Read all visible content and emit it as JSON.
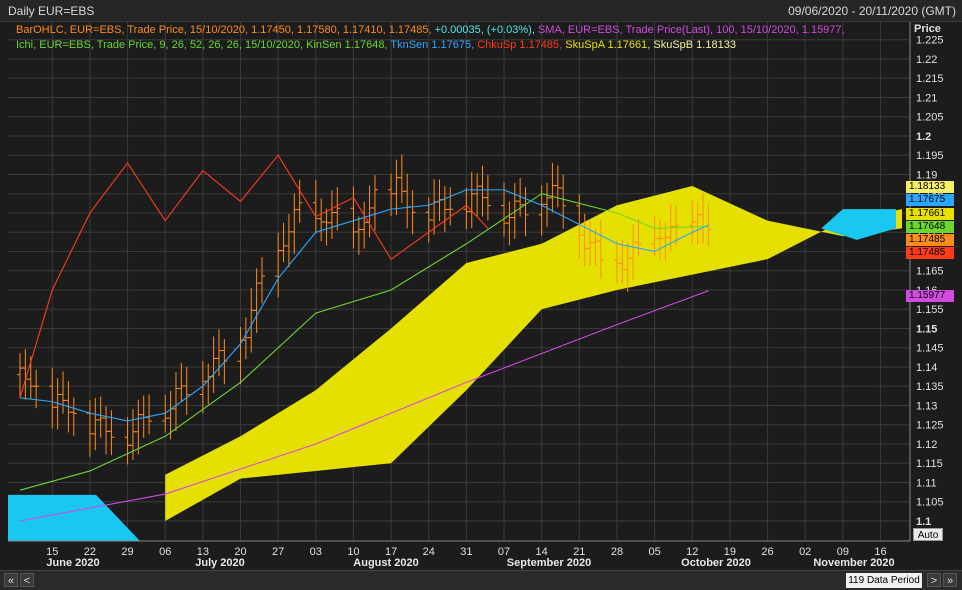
{
  "header": {
    "title": "Daily EUR=EBS",
    "date_range": "09/06/2020 - 20/11/2020 (GMT)"
  },
  "legend": {
    "line1": [
      {
        "text": "BarOHLC, EUR=EBS, Trade Price, 15/10/2020, 1.17450, 1.17580, 1.17410, 1.17485,",
        "color": "#ff8c1a"
      },
      {
        "text": " +0.00035, (+0.03%),",
        "color": "#4fe8e8"
      },
      {
        "text": " SMA, EUR=EBS, Trade Price(Last), 100, 15/10/2020, 1.15977,",
        "color": "#d24be0"
      }
    ],
    "line2": [
      {
        "text": "Ichi, EUR=EBS, Trade Price, 9, 26, 52, 26, 26, 15/10/2020, KinSen 1.17648,",
        "color": "#6bd62e"
      },
      {
        "text": " TknSen 1.17675,",
        "color": "#2aa7ff"
      },
      {
        "text": " ChkuSp 1.17485,",
        "color": "#ff3b1a"
      },
      {
        "text": " SkuSpA 1.17661,",
        "color": "#e8e000"
      },
      {
        "text": " SkuSpB 1.18133",
        "color": "#f2f2a0"
      }
    ]
  },
  "price_axis": {
    "label": "Price",
    "ticks": [
      "1.225",
      "1.22",
      "1.215",
      "1.21",
      "1.205",
      "1.2",
      "1.195",
      "1.19",
      "1.185",
      "1.18",
      "1.175",
      "1.17",
      "1.165",
      "1.16",
      "1.155",
      "1.15",
      "1.145",
      "1.14",
      "1.135",
      "1.13",
      "1.125",
      "1.12",
      "1.115",
      "1.11",
      "1.105",
      "1.1"
    ],
    "bold_ticks": [
      "1.2",
      "1.15",
      "1.1"
    ],
    "tags": [
      {
        "text": "1.18133",
        "bg": "#f5f06a"
      },
      {
        "text": "1.17675",
        "bg": "#2aa7ff"
      },
      {
        "text": "1.17661",
        "bg": "#e8e000"
      },
      {
        "text": "1.17648",
        "bg": "#6bd62e"
      },
      {
        "text": "1.17485",
        "bg": "#ff8c1a"
      },
      {
        "text": "1.17485",
        "bg": "#ff3b1a"
      },
      {
        "text": "1.15977",
        "bg": "#d24be0"
      }
    ]
  },
  "time_axis": {
    "day_ticks": [
      "15",
      "22",
      "29",
      "06",
      "13",
      "20",
      "27",
      "03",
      "10",
      "17",
      "24",
      "31",
      "07",
      "14",
      "21",
      "28",
      "05",
      "12",
      "19",
      "26",
      "02",
      "09",
      "16"
    ],
    "months": [
      "June 2020",
      "July 2020",
      "August 2020",
      "September 2020",
      "October 2020",
      "November 2020"
    ]
  },
  "controls": {
    "period": "119 Data Period",
    "auto": "Auto",
    "nav_left_fast": "«",
    "nav_left": "<",
    "nav_right": ">",
    "nav_right_fast": "»"
  },
  "colors": {
    "background": "#1c1c1c",
    "grid": "#3a3a3a",
    "cloud_bull": "#e6e000",
    "cloud_bear": "#18c8f0",
    "tenkan": "#2aa7ff",
    "kijun": "#6bd62e",
    "chikou": "#ff3b1a",
    "sma": "#d24be0",
    "bars": "#ff8c1a"
  },
  "chart_data": {
    "type": "line",
    "title": "Daily EUR=EBS",
    "ylabel": "Price",
    "ylim": [
      1.1,
      1.227
    ],
    "x_start": "2020-06-09",
    "x_end": "2020-11-20",
    "series": [
      {
        "name": "BarOHLC close",
        "color": "#ff8c1a",
        "x": [
          "2020-06-09",
          "2020-06-12",
          "2020-06-16",
          "2020-06-19",
          "2020-06-23",
          "2020-06-26",
          "2020-06-30",
          "2020-07-03",
          "2020-07-07",
          "2020-07-10",
          "2020-07-14",
          "2020-07-17",
          "2020-07-21",
          "2020-07-24",
          "2020-07-28",
          "2020-07-31",
          "2020-08-04",
          "2020-08-07",
          "2020-08-11",
          "2020-08-14",
          "2020-08-18",
          "2020-08-21",
          "2020-08-25",
          "2020-08-28",
          "2020-09-01",
          "2020-09-04",
          "2020-09-08",
          "2020-09-11",
          "2020-09-15",
          "2020-09-18",
          "2020-09-22",
          "2020-09-25",
          "2020-09-29",
          "2020-10-02",
          "2020-10-06",
          "2020-10-09",
          "2020-10-13",
          "2020-10-15"
        ],
        "y": [
          1.138,
          1.133,
          1.131,
          1.127,
          1.125,
          1.122,
          1.123,
          1.127,
          1.13,
          1.134,
          1.139,
          1.142,
          1.149,
          1.163,
          1.172,
          1.181,
          1.177,
          1.179,
          1.174,
          1.184,
          1.187,
          1.179,
          1.181,
          1.181,
          1.184,
          1.183,
          1.179,
          1.181,
          1.185,
          1.183,
          1.172,
          1.168,
          1.166,
          1.171,
          1.173,
          1.175,
          1.178,
          1.1748
        ]
      },
      {
        "name": "TknSen",
        "color": "#2aa7ff",
        "x": [
          "2020-06-09",
          "2020-06-15",
          "2020-06-22",
          "2020-06-29",
          "2020-07-06",
          "2020-07-13",
          "2020-07-20",
          "2020-07-27",
          "2020-08-03",
          "2020-08-10",
          "2020-08-17",
          "2020-08-24",
          "2020-08-31",
          "2020-09-07",
          "2020-09-14",
          "2020-09-21",
          "2020-09-28",
          "2020-10-05",
          "2020-10-12",
          "2020-10-15"
        ],
        "y": [
          1.132,
          1.131,
          1.128,
          1.126,
          1.128,
          1.135,
          1.146,
          1.163,
          1.175,
          1.178,
          1.181,
          1.182,
          1.186,
          1.186,
          1.182,
          1.177,
          1.172,
          1.17,
          1.175,
          1.1768
        ]
      },
      {
        "name": "KinSen",
        "color": "#6bd62e",
        "x": [
          "2020-06-09",
          "2020-06-22",
          "2020-07-06",
          "2020-07-20",
          "2020-08-03",
          "2020-08-17",
          "2020-08-31",
          "2020-09-14",
          "2020-09-28",
          "2020-10-05",
          "2020-10-15"
        ],
        "y": [
          1.108,
          1.113,
          1.122,
          1.136,
          1.154,
          1.16,
          1.172,
          1.185,
          1.18,
          1.176,
          1.1765
        ]
      },
      {
        "name": "ChkuSp",
        "color": "#ff3b1a",
        "x": [
          "2020-06-09",
          "2020-06-15",
          "2020-06-22",
          "2020-06-29",
          "2020-07-06",
          "2020-07-13",
          "2020-07-20",
          "2020-07-27",
          "2020-08-03",
          "2020-08-10",
          "2020-08-17",
          "2020-08-24",
          "2020-08-31",
          "2020-09-04"
        ],
        "y": [
          1.132,
          1.16,
          1.18,
          1.193,
          1.178,
          1.191,
          1.183,
          1.195,
          1.179,
          1.184,
          1.168,
          1.175,
          1.182,
          1.176
        ]
      },
      {
        "name": "SMA 100",
        "color": "#d24be0",
        "x": [
          "2020-06-09",
          "2020-07-06",
          "2020-08-03",
          "2020-08-31",
          "2020-09-28",
          "2020-10-15"
        ],
        "y": [
          1.1,
          1.107,
          1.12,
          1.136,
          1.151,
          1.1598
        ]
      },
      {
        "name": "SkuSpA",
        "color": "#e8e000",
        "x": [
          "2020-07-06",
          "2020-07-20",
          "2020-08-03",
          "2020-08-17",
          "2020-08-31",
          "2020-09-14",
          "2020-09-28",
          "2020-10-12",
          "2020-10-26",
          "2020-11-09",
          "2020-11-20"
        ],
        "y": [
          1.112,
          1.122,
          1.134,
          1.15,
          1.167,
          1.172,
          1.182,
          1.187,
          1.178,
          1.174,
          1.176
        ]
      },
      {
        "name": "SkuSpB",
        "color": "#f2f2a0",
        "x": [
          "2020-07-06",
          "2020-07-20",
          "2020-08-03",
          "2020-08-17",
          "2020-08-31",
          "2020-09-14",
          "2020-09-28",
          "2020-10-12",
          "2020-10-26",
          "2020-11-09",
          "2020-11-20"
        ],
        "y": [
          1.1,
          1.111,
          1.113,
          1.115,
          1.134,
          1.155,
          1.16,
          1.164,
          1.168,
          1.178,
          1.181
        ]
      }
    ]
  }
}
